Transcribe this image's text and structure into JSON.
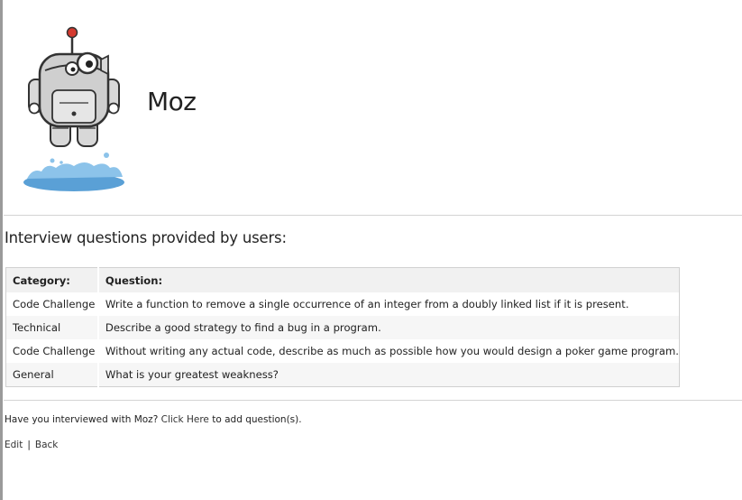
{
  "company": {
    "name": "Moz",
    "logo_icon": "roger-mozbot-robot-icon"
  },
  "section": {
    "title": "Interview questions provided by users:"
  },
  "table": {
    "headers": {
      "category": "Category:",
      "question": "Question:"
    },
    "rows": [
      {
        "category": "Code Challenge",
        "question": "Write a function to remove a single occurrence of an integer from a doubly linked list if it is present."
      },
      {
        "category": "Technical",
        "question": "Describe a good strategy to find a bug in a program."
      },
      {
        "category": "Code Challenge",
        "question": "Without writing any actual code, describe as much as possible how you would design a poker game program."
      },
      {
        "category": "General",
        "question": "What is your greatest weakness?"
      }
    ]
  },
  "footer": {
    "prompt_before": "Have you interviewed with Moz?",
    "click_here": "Click Here",
    "prompt_after": "to add question(s).",
    "edit_label": "Edit",
    "separator": "|",
    "back_label": "Back"
  },
  "colors": {
    "text": "#222222",
    "divider": "#d4d4d4",
    "table_header_bg": "#f1f1f1",
    "row_alt_bg": "#f6f6f6",
    "logo_water": "#5aa0d6",
    "logo_antenna": "#d43a2f"
  }
}
